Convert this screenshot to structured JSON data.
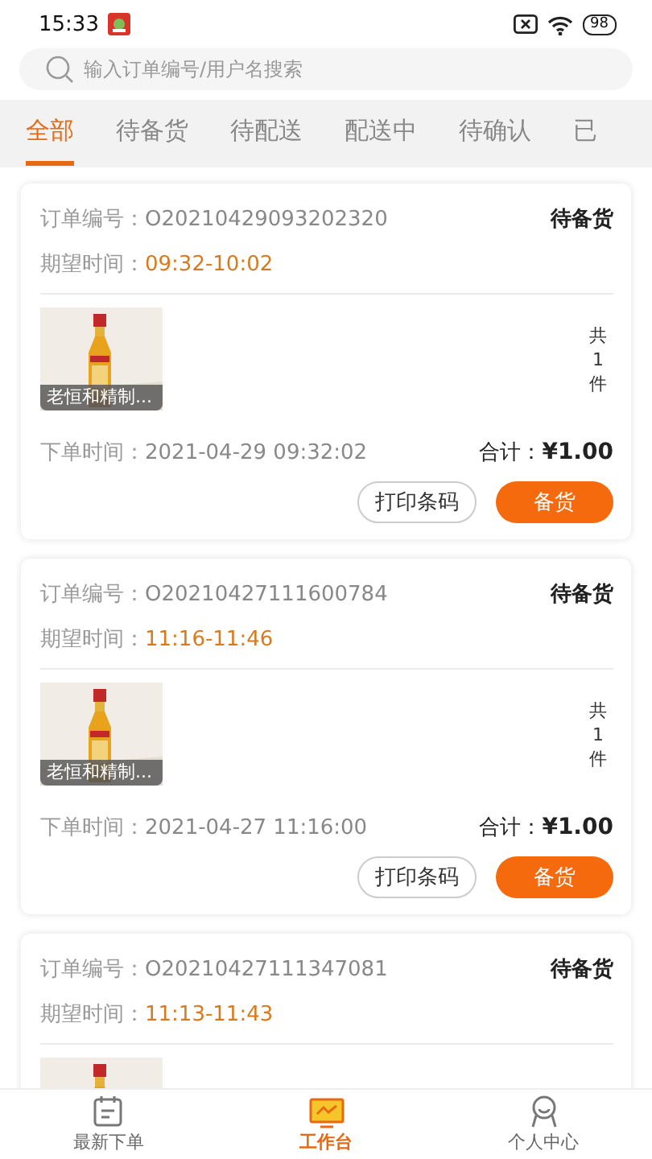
{
  "status_bar": {
    "time": "15:33",
    "battery": "98"
  },
  "search": {
    "placeholder": "输入订单编号/用户名搜索"
  },
  "tabs": [
    {
      "label": "全部",
      "selected": true
    },
    {
      "label": "待备货",
      "selected": false
    },
    {
      "label": "待配送",
      "selected": false
    },
    {
      "label": "配送中",
      "selected": false
    },
    {
      "label": "待确认",
      "selected": false
    },
    {
      "label": "已",
      "selected": false
    }
  ],
  "orders": [
    {
      "order_label": "订单编号：",
      "order_no": "O20210429093202320",
      "status": "待备货",
      "expect_label": "期望时间：",
      "expect_time": "09:32-10:02",
      "product": {
        "kind": "picture",
        "name": "老恒和精制...",
        "count": [
          "共",
          "1",
          "件"
        ]
      },
      "placed_label": "下单时间：",
      "placed_time": "2021-04-29 09:32:02",
      "total_label": "合计：",
      "total": "¥1.00",
      "buttons": [
        {
          "label": "打印条码",
          "kind": "outline"
        },
        {
          "label": "备货",
          "kind": "primary"
        }
      ]
    },
    {
      "order_label": "订单编号：",
      "order_no": "O20210427111600784",
      "status": "待备货",
      "expect_label": "期望时间：",
      "expect_time": "11:16-11:46",
      "product": {
        "kind": "picture",
        "name": "老恒和精制...",
        "count": [
          "共",
          "1",
          "件"
        ]
      },
      "placed_label": "下单时间：",
      "placed_time": "2021-04-27 11:16:00",
      "total_label": "合计：",
      "total": "¥1.00",
      "buttons": [
        {
          "label": "打印条码",
          "kind": "outline"
        },
        {
          "label": "备货",
          "kind": "primary"
        }
      ]
    },
    {
      "order_label": "订单编号：",
      "order_no": "O20210427111347081",
      "status": "待备货",
      "expect_label": "期望时间：",
      "expect_time": "11:13-11:43"
    }
  ],
  "nav": [
    {
      "label": "最新下单",
      "selected": false,
      "kind": "orders"
    },
    {
      "label": "工作台",
      "selected": true,
      "kind": "workbench"
    },
    {
      "label": "个人中心",
      "selected": false,
      "kind": "profile"
    }
  ]
}
